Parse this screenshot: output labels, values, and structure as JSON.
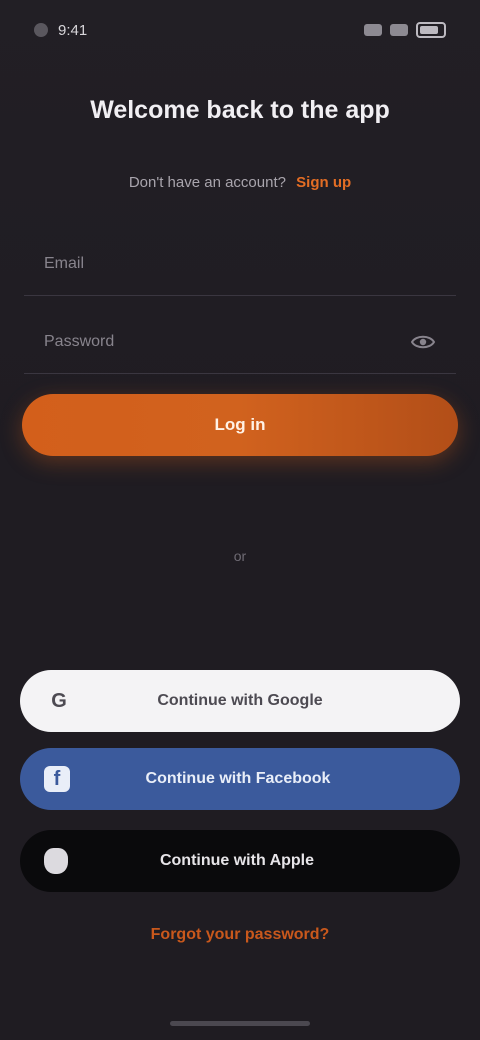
{
  "status_bar": {
    "time": "9:41"
  },
  "header": {
    "title": "Welcome back to the app",
    "signup_prompt": "Don't have an account?",
    "signup_link": "Sign up"
  },
  "form": {
    "email_placeholder": "Email",
    "password_placeholder": "Password"
  },
  "login": {
    "label": "Log in"
  },
  "divider": {
    "label": "or"
  },
  "social": {
    "google_label": "Continue with Google",
    "google_icon": "G",
    "facebook_label": "Continue with Facebook",
    "facebook_icon": "f",
    "apple_label": "Continue with Apple"
  },
  "footer": {
    "forgot_label": "Forgot your password?"
  },
  "colors": {
    "accent": "#d35f1b",
    "facebook": "#3b5a9c",
    "background": "#201d23"
  }
}
